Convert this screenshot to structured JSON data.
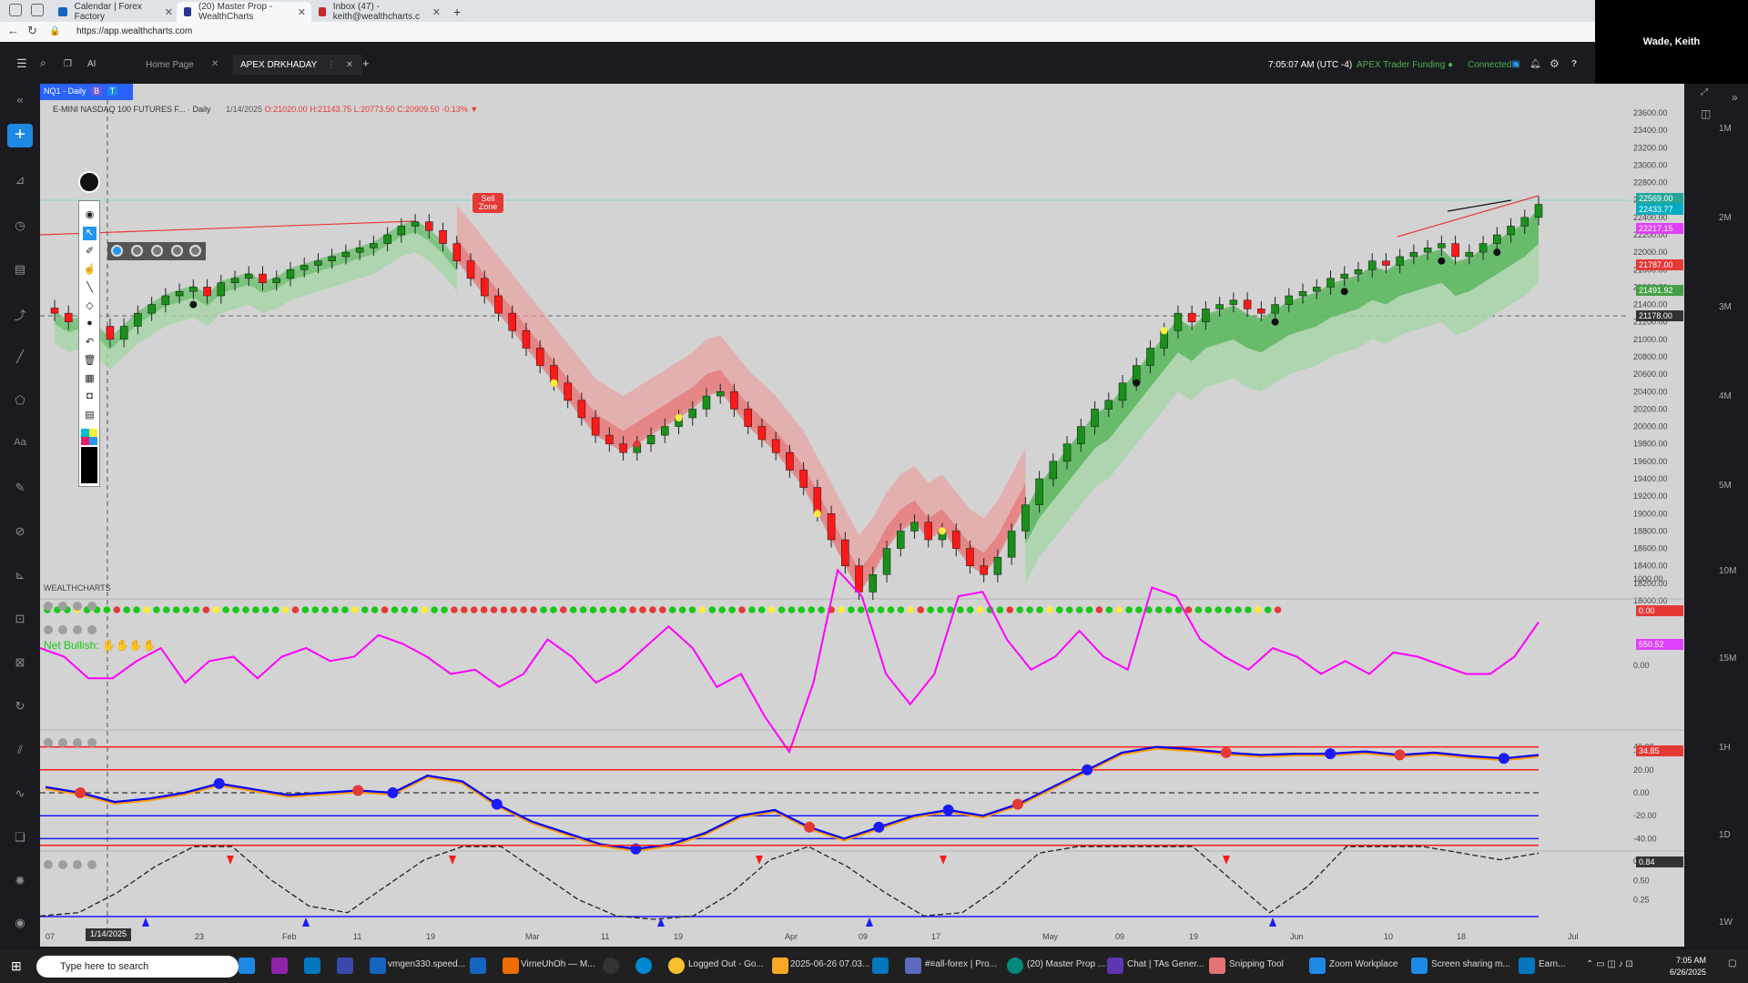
{
  "browser": {
    "tabs": [
      {
        "title": "Calendar | Forex Factory",
        "color": "#1565c0"
      },
      {
        "title": "(20) Master Prop - WealthCharts",
        "color": "#283593"
      },
      {
        "title": "Inbox (47) - keith@wealthcharts.c",
        "color": "#c62828"
      }
    ],
    "url": "https://app.wealthcharts.com",
    "profile": "Wade, Keith"
  },
  "app": {
    "tab_home": "Home Page",
    "tab_active": "APEX DRKHADAY",
    "time": "7:05:07 AM",
    "timezone": "(UTC -4)",
    "funding": "APEX Trader Funding",
    "status": "Connected"
  },
  "chart": {
    "symbol_tab": "NQ1 - Daily",
    "badge_b": "B",
    "badge_t": "T",
    "instrument": "E-MINI NASDAQ 100 FUTURES F...",
    "interval": "· Daily",
    "ohlc": {
      "date": "1/14/2025",
      "o": "O:21020.00",
      "h": "H:21143.75",
      "l": "L:20773.50",
      "c": "C:20909.50",
      "chg": "-0.13%"
    },
    "sell_zone": "Sell Zone",
    "brand": "WEALTHCHARTS",
    "net_bullish": "Net Bullish:",
    "price_ticks": [
      "23600.00",
      "23400.00",
      "23200.00",
      "23000.00",
      "22800.00",
      "22600.00",
      "22400.00",
      "22200.00",
      "22000.00",
      "21800.00",
      "21600.00",
      "21400.00",
      "21200.00",
      "21000.00",
      "20800.00",
      "20600.00",
      "20400.00",
      "20200.00",
      "20000.00",
      "19800.00",
      "19600.00",
      "19400.00",
      "19200.00",
      "19000.00",
      "18800.00",
      "18600.00",
      "18400.00",
      "18200.00",
      "18000.00"
    ],
    "price_labels": [
      {
        "text": "22569.00",
        "color": "#26a69a"
      },
      {
        "text": "22433.77",
        "color": "#00acc1"
      },
      {
        "text": "22217.15",
        "color": "#e040fb"
      },
      {
        "text": "21787.00",
        "color": "#e53935"
      },
      {
        "text": "21491.92",
        "color": "#43a047"
      },
      {
        "text": "21178.00",
        "color": "#333333"
      }
    ],
    "osc1_ticks": [
      "1000.00",
      "0.00",
      "-1000.00"
    ],
    "osc1_value": "550.52",
    "dots_value": "0.00",
    "osc2_ticks": [
      "40.00",
      "20.00",
      "0.00",
      "-20.00",
      "-40.00"
    ],
    "osc2_value": "34.85",
    "osc3_ticks": [
      "0.75",
      "0.50",
      "0.25"
    ],
    "osc3_value": "0.84",
    "date_label": "1/14/2025",
    "x_ticks": [
      "07",
      "23",
      "Feb",
      "11",
      "19",
      "Mar",
      "11",
      "19",
      "Apr",
      "09",
      "17",
      "May",
      "09",
      "19",
      "Jun",
      "10",
      "18",
      "Jul"
    ],
    "timeframes": [
      "1M",
      "2M",
      "3M",
      "4M",
      "5M",
      "10M",
      "15M",
      "1H",
      "1D",
      "1W"
    ]
  },
  "taskbar": {
    "search": "Type here to search",
    "items": [
      "vmgen330.speed...",
      "VirneUhOh — M...",
      "Logged Out - Go...",
      "2025-06-26 07.03...",
      "#≡all-forex | Pro...",
      "(20) Master Prop ...",
      "Chat | TAs Gener...",
      "Snipping Tool",
      "Zoom Workplace",
      "Screen sharing m...",
      "Earn..."
    ],
    "time": "7:05 AM",
    "date": "6/26/2025"
  }
}
